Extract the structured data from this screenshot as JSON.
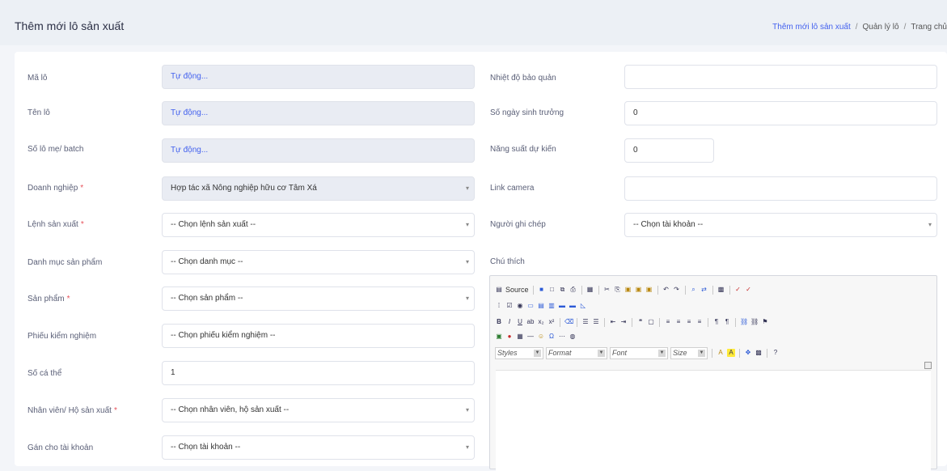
{
  "header": {
    "title": "Thêm mới lô sản xuất",
    "breadcrumb": [
      "Thêm mới lô sản xuất",
      "Quản lý lô",
      "Trang chủ"
    ]
  },
  "form": {
    "left": [
      {
        "label": "Mã lô",
        "value": "Tự động...",
        "required": false
      },
      {
        "label": "Tên lô",
        "value": "Tự động...",
        "required": false
      },
      {
        "label": "Số lô mẹ/ batch",
        "value": "Tự động...",
        "required": false
      },
      {
        "label": "Doanh nghiệp",
        "value": "Hợp tác xã Nông nghiệp hữu cơ Tâm Xá",
        "required": true
      },
      {
        "label": "Lệnh sản xuất",
        "value": "-- Chọn lệnh sản xuất --",
        "required": true
      },
      {
        "label": "Danh mục sản phẩm",
        "value": "-- Chọn danh mục --",
        "required": false
      },
      {
        "label": "Sản phẩm",
        "value": "-- Chọn sản phẩm --",
        "required": true
      },
      {
        "label": "Phiếu kiểm nghiệm",
        "value": "-- Chọn phiếu kiểm nghiệm --",
        "required": false
      },
      {
        "label": "Số cá thể",
        "value": "1",
        "required": false
      },
      {
        "label": "Nhân viên/ Hộ sản xuất",
        "value": "-- Chọn nhân viên, hộ sản xuất --",
        "required": true
      },
      {
        "label": "Gán cho tài khoản",
        "value": "-- Chọn tài khoản --",
        "required": false
      }
    ],
    "right": [
      {
        "label": "Nhiệt độ bảo quản",
        "value": ""
      },
      {
        "label": "Số ngày sinh trưởng",
        "value": "0"
      },
      {
        "label": "Năng suất dự kiến",
        "value": "0"
      },
      {
        "label": "Link camera",
        "value": ""
      },
      {
        "label": "Người ghi chép",
        "value": "-- Chọn tài khoản --"
      },
      {
        "label": "Chú thích",
        "value": ""
      }
    ],
    "required_mark": "*"
  },
  "editor": {
    "source_label": "Source",
    "styles_label": "Styles",
    "format_label": "Format",
    "font_label": "Font",
    "size_label": "Size"
  },
  "colors": {
    "accent": "#4361ee",
    "required": "#e7515a",
    "disabled_bg": "#e9ecf3"
  }
}
